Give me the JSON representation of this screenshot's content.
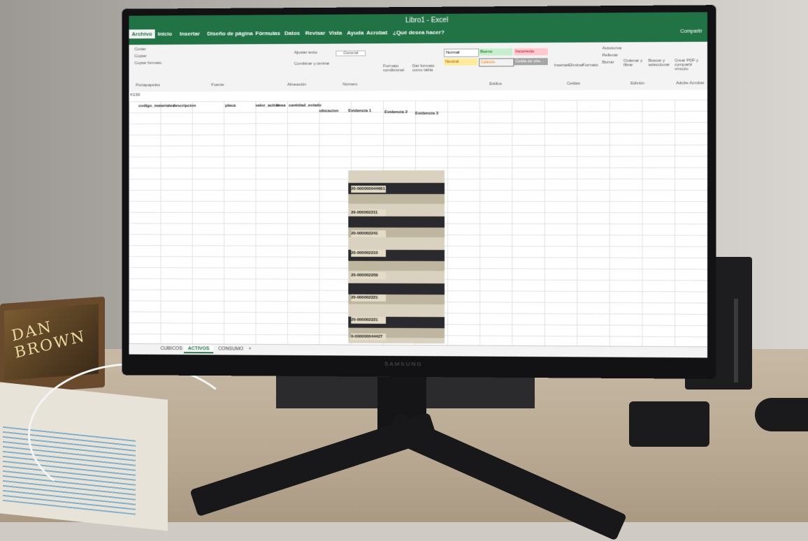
{
  "excel": {
    "app_title": "Libro1 - Excel",
    "tabs": [
      "Archivo",
      "Inicio",
      "Insertar",
      "Diseño de página",
      "Fórmulas",
      "Datos",
      "Revisar",
      "Vista",
      "Ayuda",
      "Acrobat"
    ],
    "search": "¿Qué desea hacer?",
    "share": "Compartir",
    "ribbon": {
      "paste_group": "Portapapeles",
      "cut": "Cortar",
      "copy": "Copiar",
      "copy_format": "Copiar formato",
      "font_group": "Fuente",
      "alignment_group": "Alineación",
      "wrap": "Ajustar texto",
      "merge": "Combinar y centrar",
      "number_group": "Número",
      "number_format": "General",
      "styles_group": "Estilos",
      "conditional": "Formato condicional",
      "table_format": "Dar formato como tabla",
      "styles": [
        "Normal",
        "Bueno",
        "Incorrecto",
        "Neutral",
        "Cálculo",
        "Celda de che..."
      ],
      "cells_group": "Celdas",
      "insert": "Insertar",
      "delete": "Eliminar",
      "format": "Formato",
      "autosum": "Autosuma",
      "fill": "Rellenar",
      "clear": "Borrar",
      "sort": "Ordenar y filtrar",
      "find": "Buscar y seleccionar",
      "editing_group": "Edición",
      "pdf_create": "Crear PDF y compartir vínculo",
      "adobe_group": "Adobe Acrobat"
    },
    "namebox": "K130",
    "headers": [
      "codigo_materiales",
      "descripcion",
      "placa",
      "valor_activo",
      "linea",
      "cantidad_estado",
      "ubicacion",
      "Evidencia 1",
      "Evidencia 2",
      "Evidencia 3"
    ],
    "plates": [
      "20-000000044661",
      "20-000002211",
      "20-000002241",
      "20-000002210",
      "20-000002209",
      "20-000002221",
      "20-000002221",
      "0-000000044427"
    ],
    "sheet_tabs": [
      "CUBICOS",
      "ACTIVOS",
      "CONSUMO"
    ],
    "add_sheet": "+"
  },
  "monitor": {
    "brand": "SAMSUNG"
  },
  "book": {
    "title": "DAN BROWN"
  }
}
